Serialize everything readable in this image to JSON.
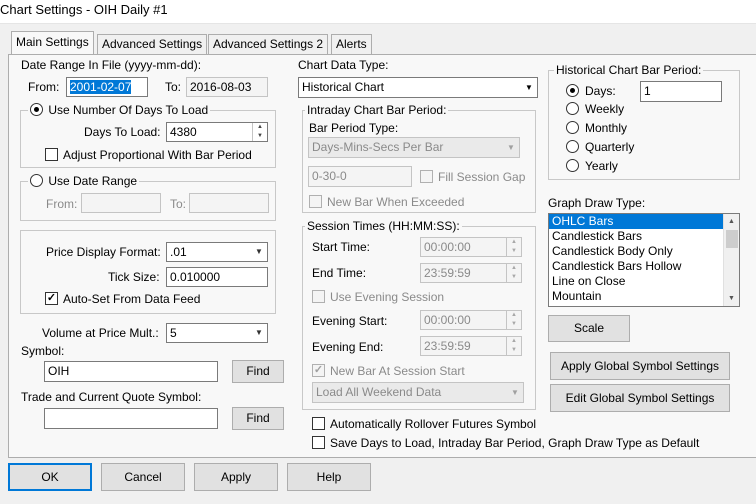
{
  "window": {
    "title": "Chart Settings - OIH  Daily  #1"
  },
  "tabs": [
    {
      "label": "Main Settings"
    },
    {
      "label": "Advanced Settings"
    },
    {
      "label": "Advanced Settings 2"
    },
    {
      "label": "Alerts"
    }
  ],
  "date_range": {
    "label": "Date Range In File (yyyy-mm-dd):",
    "from_label": "From:",
    "from_value": "2001-02-07",
    "to_label": "To:",
    "to_value": "2016-08-03"
  },
  "days_group": {
    "radio_label": "Use Number Of Days To Load",
    "days_label": "Days To Load:",
    "days_value": "4380",
    "adjust_label": "Adjust Proportional With Bar Period"
  },
  "date_range_group": {
    "radio_label": "Use Date Range",
    "from_label": "From:",
    "to_label": "To:"
  },
  "price_group": {
    "format_label": "Price Display Format:",
    "format_value": ".01",
    "tick_label": "Tick Size:",
    "tick_value": "0.010000",
    "autoset_label": "Auto-Set From Data Feed"
  },
  "volume": {
    "label": "Volume at Price Mult.:",
    "value": "5"
  },
  "symbol": {
    "label": "Symbol:",
    "value": "OIH",
    "find": "Find"
  },
  "trade_symbol": {
    "label": "Trade and Current Quote Symbol:",
    "value": "",
    "find": "Find"
  },
  "chart_data_type": {
    "label": "Chart Data Type:",
    "value": "Historical Chart"
  },
  "intraday": {
    "title": "Intraday Chart Bar Period:",
    "bar_type_label": "Bar Period Type:",
    "bar_type_value": "Days-Mins-Secs Per Bar",
    "period_value": "0-30-0",
    "fill_gap_label": "Fill Session Gap",
    "new_bar_label": "New Bar When Exceeded"
  },
  "session": {
    "title": "Session Times (HH:MM:SS):",
    "start_label": "Start Time:",
    "start_value": "00:00:00",
    "end_label": "End Time:",
    "end_value": "23:59:59",
    "use_evening_label": "Use Evening Session",
    "evening_start_label": "Evening Start:",
    "evening_start_value": "00:00:00",
    "evening_end_label": "Evening End:",
    "evening_end_value": "23:59:59",
    "new_bar_label": "New Bar At Session Start",
    "weekend_value": "Load All Weekend Data"
  },
  "rollover_label": "Automatically Rollover Futures Symbol",
  "save_default_label": "Save Days to Load, Intraday Bar Period, Graph Draw Type as Default",
  "hist_period": {
    "title": "Historical Chart Bar Period:",
    "days_label": "Days:",
    "days_value": "1",
    "options": [
      "Weekly",
      "Monthly",
      "Quarterly",
      "Yearly"
    ]
  },
  "graph_draw": {
    "label": "Graph Draw Type:",
    "items": [
      "OHLC Bars",
      "Candlestick Bars",
      "Candlestick Body Only",
      "Candlestick Bars Hollow",
      "Line on Close",
      "Mountain"
    ]
  },
  "scale_button": "Scale",
  "apply_global_button": "Apply Global Symbol Settings",
  "edit_global_button": "Edit Global Symbol Settings",
  "footer": {
    "ok": "OK",
    "cancel": "Cancel",
    "apply": "Apply",
    "help": "Help"
  }
}
